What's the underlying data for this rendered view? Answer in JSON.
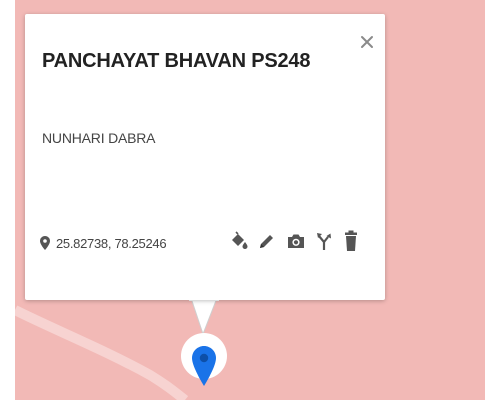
{
  "popup": {
    "title": "PANCHAYAT BHAVAN PS248",
    "subtitle": "NUNHARI DABRA",
    "coordinates": "25.82738, 78.25246"
  },
  "toolbar": {
    "icons": [
      "fill-color-icon",
      "pencil-icon",
      "camera-icon",
      "directions-icon",
      "trash-icon"
    ]
  },
  "colors": {
    "map_background": "#f2b9b6",
    "marker": "#1a73e8",
    "icon": "#555555"
  }
}
